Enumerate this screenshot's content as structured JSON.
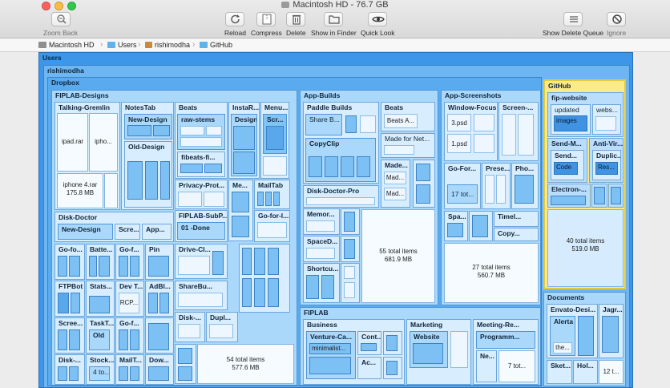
{
  "window": {
    "title": "Macintosh HD - 76.7 GB"
  },
  "toolbar": {
    "zoom_back": "Zoom Back",
    "reload": "Reload",
    "compress": "Compress",
    "delete": "Delete",
    "show_in_finder": "Show in Finder",
    "quick_look": "Quick Look",
    "show_delete_queue": "Show Delete Queue",
    "ignore": "Ignore"
  },
  "path": [
    "Macintosh HD",
    "Users",
    "rishimodha",
    "GitHub"
  ],
  "map": {
    "users": "Users",
    "rishimodha": "rishimodha",
    "dropbox": "Dropbox",
    "fiplab_designs": "FIPLAB-Designs",
    "talking_gremlin": "Talking-Gremlin",
    "ipad_rar": "ipad.rar",
    "ipho": "ipho...",
    "iphone4_name": "iphone 4.rar",
    "iphone4_size": "175.8 MB",
    "notestab": "NotesTab",
    "new_design": "New-Design",
    "old_design": "Old-Design",
    "beats": "Beats",
    "raw_stems": "raw-stems",
    "fibeats": "fibeats-fi...",
    "instar": "InstaR...",
    "design": "Design",
    "menu": "Menu...",
    "scr": "Scr...",
    "privacy_prot": "Privacy-Prot...",
    "me": "Me...",
    "mailtab": "MailTab",
    "fiplab_subp": "FIPLAB-SubP...",
    "done": "01 -Done",
    "go_for_1": "Go-for-l...",
    "disk_doctor": "Disk-Doctor",
    "dd_new_design": "New-Design",
    "scre": "Scre...",
    "app": "App...",
    "go_fo": "Go-fo...",
    "batte": "Batte...",
    "go_f": "Go-f...",
    "pin": "Pin",
    "ftpbot": "FTPBot",
    "stats": "Stats...",
    "dev_t": "Dev T...",
    "adbl": "AdBl...",
    "rcp": "RCP...",
    "scree": "Scree...",
    "tasktab": "TaskT...",
    "old": "Old",
    "go_f2": "Go-f...",
    "disk": "Disk-...",
    "stock": "Stock...",
    "four_to": "4 to...",
    "mailt": "MailT...",
    "dow": "Dow...",
    "drive_cl": "Drive-Cl...",
    "sharebu": "ShareBu...",
    "disk2": "Disk-...",
    "dupl": "Dupl...",
    "fd_count": "54 total items",
    "fd_size": "577.6 MB",
    "app_builds": "App-Builds",
    "paddle_builds": "Paddle Builds",
    "share_b": "Share B...",
    "copyclip": "CopyClip",
    "ab_beats": "Beats",
    "beats_a": "Beats A...",
    "made_for_net": "Made for Net...",
    "made1": "Made...",
    "mad": "Mad...",
    "mad2": "Mad...",
    "disk_doctor_pro": "Disk-Doctor-Pro",
    "memor": "Memor...",
    "spaced": "SpaceD...",
    "shortcu": "Shortcu...",
    "ab_count": "55 total items",
    "ab_size": "681.9 MB",
    "app_screenshots": "App-Screenshots",
    "window_focus": "Window-Focus",
    "screen": "Screen-...",
    "psd3": "3.psd",
    "psd1": "1.psd",
    "go_for": "Go-For...",
    "prese": "Prese...",
    "pho": "Pho...",
    "seventeen_tot": "17 tot...",
    "spa": "Spa...",
    "timel": "Timel...",
    "copy": "Copy...",
    "as_count": "27 total items",
    "as_size": "560.7 MB",
    "fiplab": "FIPLAB",
    "business": "Business",
    "venture_ca": "Venture-Ca...",
    "minimalist": "minimalist...",
    "cont": "Cont...",
    "ac": "Ac...",
    "marketing": "Marketing",
    "website": "Website",
    "meeting_re": "Meeting-Re...",
    "programm": "Programm...",
    "ne": "Ne...",
    "seven_tot": "7 tot...",
    "github": "GitHub",
    "fip_website": "fip-website",
    "updated": "updated",
    "images": "images",
    "webs": "webs...",
    "send_m": "Send-M...",
    "anti_vir": "Anti-Vir...",
    "send": "Send...",
    "code": "Code",
    "duplic": "Duplic...",
    "res": "Res...",
    "electron": "Electron-...",
    "gh_count": "40 total items",
    "gh_size": "519.0 MB",
    "documents": "Documents",
    "envato": "Envato-Desi...",
    "jagr": "Jagr...",
    "alerta": "Alerta",
    "the": "the...",
    "sket": "Sket...",
    "hol": "Hol...",
    "twelve_t": "12 t..."
  },
  "icons": {
    "zoom_back": "magnifier-icon",
    "reload": "reload-icon",
    "compress": "compress-icon",
    "delete": "trash-icon",
    "show_in_finder": "folder-icon",
    "quick_look": "eye-icon",
    "show_delete_queue": "list-icon",
    "ignore": "ignore-icon"
  },
  "colors": {
    "selected": "#fbea88",
    "map_base": "#3d96e8",
    "tile": "#7cc0f4"
  }
}
